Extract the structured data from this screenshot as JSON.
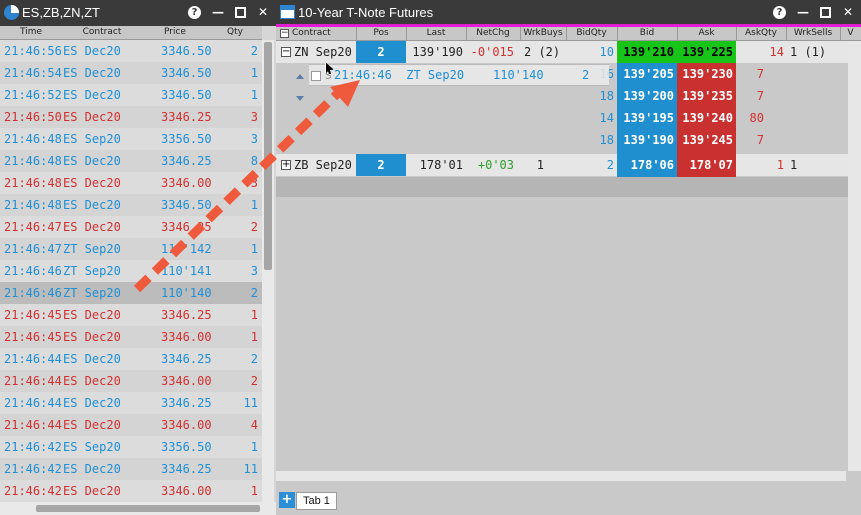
{
  "ts_window": {
    "title": "ES,ZB,ZN,ZT",
    "columns": [
      "Time",
      "Contract",
      "Price",
      "Qty"
    ],
    "rows": [
      {
        "time": "21:46:56",
        "contract": "ES Dec20",
        "price": "3346.50",
        "qty": "2",
        "color": "blue"
      },
      {
        "time": "21:46:54",
        "contract": "ES Dec20",
        "price": "3346.50",
        "qty": "1",
        "color": "blue"
      },
      {
        "time": "21:46:52",
        "contract": "ES Dec20",
        "price": "3346.50",
        "qty": "1",
        "color": "blue"
      },
      {
        "time": "21:46:50",
        "contract": "ES Dec20",
        "price": "3346.25",
        "qty": "3",
        "color": "red"
      },
      {
        "time": "21:46:48",
        "contract": "ES Sep20",
        "price": "3356.50",
        "qty": "3",
        "color": "blue"
      },
      {
        "time": "21:46:48",
        "contract": "ES Dec20",
        "price": "3346.25",
        "qty": "8",
        "color": "blue"
      },
      {
        "time": "21:46:48",
        "contract": "ES Dec20",
        "price": "3346.00",
        "qty": "3",
        "color": "red"
      },
      {
        "time": "21:46:48",
        "contract": "ES Dec20",
        "price": "3346.50",
        "qty": "1",
        "color": "blue"
      },
      {
        "time": "21:46:47",
        "contract": "ES Dec20",
        "price": "3346.25",
        "qty": "2",
        "color": "red"
      },
      {
        "time": "21:46:47",
        "contract": "ZT Sep20",
        "price": "110'142",
        "qty": "1",
        "color": "blue"
      },
      {
        "time": "21:46:46",
        "contract": "ZT Sep20",
        "price": "110'141",
        "qty": "3",
        "color": "blue"
      },
      {
        "time": "21:46:46",
        "contract": "ZT Sep20",
        "price": "110'140",
        "qty": "2",
        "color": "blue"
      },
      {
        "time": "21:46:45",
        "contract": "ES Dec20",
        "price": "3346.25",
        "qty": "1",
        "color": "red"
      },
      {
        "time": "21:46:45",
        "contract": "ES Dec20",
        "price": "3346.00",
        "qty": "1",
        "color": "red"
      },
      {
        "time": "21:46:44",
        "contract": "ES Dec20",
        "price": "3346.25",
        "qty": "2",
        "color": "blue"
      },
      {
        "time": "21:46:44",
        "contract": "ES Dec20",
        "price": "3346.00",
        "qty": "2",
        "color": "red"
      },
      {
        "time": "21:46:44",
        "contract": "ES Dec20",
        "price": "3346.25",
        "qty": "11",
        "color": "blue"
      },
      {
        "time": "21:46:44",
        "contract": "ES Dec20",
        "price": "3346.00",
        "qty": "4",
        "color": "red"
      },
      {
        "time": "21:46:42",
        "contract": "ES Sep20",
        "price": "3356.50",
        "qty": "1",
        "color": "blue"
      },
      {
        "time": "21:46:42",
        "contract": "ES Dec20",
        "price": "3346.25",
        "qty": "11",
        "color": "blue"
      },
      {
        "time": "21:46:42",
        "contract": "ES Dec20",
        "price": "3346.00",
        "qty": "1",
        "color": "red"
      }
    ]
  },
  "md_window": {
    "title": "10-Year T-Note Futures",
    "columns": [
      "Contract",
      "Pos",
      "Last",
      "NetChg",
      "WrkBuys",
      "BidQty",
      "Bid",
      "Ask",
      "AskQty",
      "WrkSells",
      "V"
    ],
    "zn": {
      "contract": "ZN Sep20",
      "pos": "2",
      "last": "139'190",
      "netchg": "-0'015",
      "wrkbuys": "2 (2)",
      "bidqty": "10",
      "bid": "139'210",
      "ask": "139'225",
      "askqty": "14",
      "wrksells": "1 (1)"
    },
    "zn_depth": [
      {
        "bidqty": "16",
        "bid": "139'205",
        "ask": "139'230",
        "askqty": "7"
      },
      {
        "bidqty": "18",
        "bid": "139'200",
        "ask": "139'235",
        "askqty": "7"
      },
      {
        "bidqty": "14",
        "bid": "139'195",
        "ask": "139'240",
        "askqty": "80"
      },
      {
        "bidqty": "18",
        "bid": "139'190",
        "ask": "139'245",
        "askqty": "7"
      }
    ],
    "zb": {
      "contract": "ZB Sep20",
      "pos": "2",
      "last": "178'01",
      "netchg": "+0'03",
      "wrkbuys": "1",
      "bidqty": "2",
      "bid": "178'06",
      "ask": "178'07",
      "askqty": "1",
      "wrksells": "1"
    },
    "drag_ghost": {
      "text": "21:46:46  ZT Sep20",
      "price": "110'140",
      "qty": "2",
      "partial_label": "S"
    },
    "tab_label": "Tab 1",
    "add_tab_symbol": "+"
  },
  "window_controls": {
    "help": "?",
    "minimize": "—",
    "close": "✕"
  },
  "expand_symbol": "−",
  "collapse_symbol": "+",
  "arrow_color": "#f05a3c"
}
